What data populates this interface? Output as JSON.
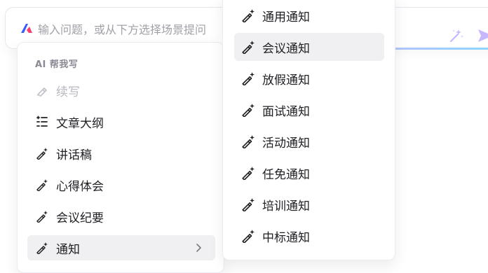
{
  "input": {
    "placeholder": "输入问题，或从下方选择场景提问",
    "brand_color": "#3b5bff",
    "magic_icon": "magic-wand-icon",
    "send_icon": "send-icon"
  },
  "left_menu": {
    "section_title": "AI 帮我写",
    "items": [
      {
        "label": "续写",
        "icon": "eraser-pen-icon",
        "disabled": true
      },
      {
        "label": "文章大纲",
        "icon": "outline-list-icon"
      },
      {
        "label": "讲话稿",
        "icon": "ai-pen-icon"
      },
      {
        "label": "心得体会",
        "icon": "ai-pen-icon"
      },
      {
        "label": "会议纪要",
        "icon": "ai-pen-icon"
      },
      {
        "label": "通知",
        "icon": "ai-pen-icon",
        "active": true,
        "has_submenu": true
      }
    ]
  },
  "submenu": {
    "items": [
      {
        "label": "通用通知"
      },
      {
        "label": "会议通知",
        "active": true
      },
      {
        "label": "放假通知"
      },
      {
        "label": "面试通知"
      },
      {
        "label": "活动通知"
      },
      {
        "label": "任免通知"
      },
      {
        "label": "培训通知"
      },
      {
        "label": "中标通知"
      }
    ]
  }
}
